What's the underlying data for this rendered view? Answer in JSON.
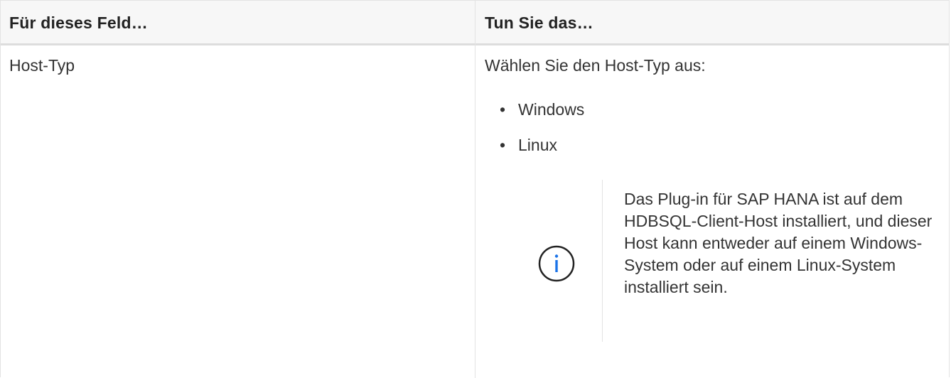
{
  "table": {
    "headers": [
      "Für dieses Feld…",
      "Tun Sie das…"
    ],
    "rows": [
      {
        "field": "Host-Typ",
        "action_intro": "Wählen Sie den Host-Typ aus:",
        "options": [
          "Windows",
          "Linux"
        ],
        "note": {
          "icon": "info-icon",
          "text": "Das Plug-in für SAP HANA ist auf dem HDBSQL-Client-Host installiert, und dieser Host kann entweder auf einem Windows-System oder auf einem Linux-System installiert sein."
        }
      }
    ]
  },
  "colors": {
    "accent": "#1a73e8",
    "border": "#e3e3e3",
    "header_bg": "#f7f7f7"
  }
}
